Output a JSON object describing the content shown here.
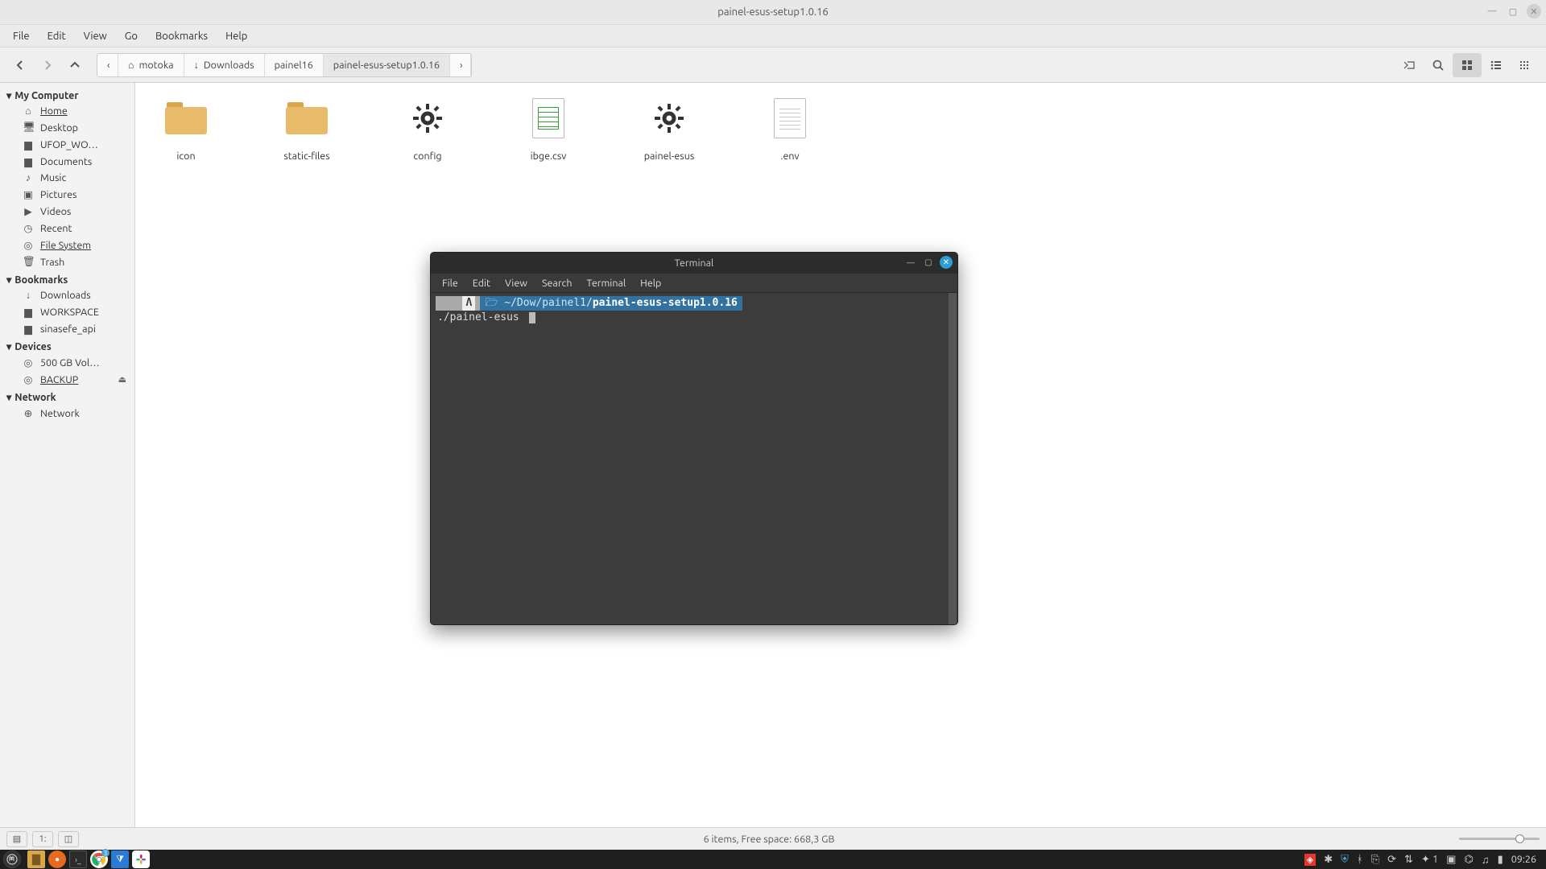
{
  "window": {
    "title": "painel-esus-setup1.0.16"
  },
  "menus": {
    "file": "File",
    "edit": "Edit",
    "view": "View",
    "go": "Go",
    "bookmarks": "Bookmarks",
    "help": "Help"
  },
  "breadcrumbs": {
    "root_user": "motoka",
    "downloads": "Downloads",
    "painel16": "painel16",
    "current": "painel-esus-setup1.0.16"
  },
  "sidebar": {
    "my_computer": "My Computer",
    "home": "Home",
    "desktop": "Desktop",
    "ufop": "UFOP_WO…",
    "documents": "Documents",
    "music": "Music",
    "pictures": "Pictures",
    "videos": "Videos",
    "recent": "Recent",
    "file_system": "File System",
    "trash": "Trash",
    "bookmarks": "Bookmarks",
    "bm_downloads": "Downloads",
    "bm_workspace": "WORKSPACE",
    "bm_sinasefe": "sinasefe_api",
    "devices": "Devices",
    "dev_500": "500 GB Vol…",
    "dev_backup": "BACKUP",
    "network": "Network",
    "net_network": "Network"
  },
  "files": {
    "icon": "icon",
    "static": "static-files",
    "config": "config",
    "ibge": "ibge.csv",
    "painel": "painel-esus",
    "env": ".env"
  },
  "status": {
    "text": "6 items, Free space: 668,3 GB"
  },
  "terminal": {
    "title": "Terminal",
    "menus": {
      "file": "File",
      "edit": "Edit",
      "view": "View",
      "search": "Search",
      "terminal": "Terminal",
      "help": "Help"
    },
    "prompt_arch": "Λ",
    "prompt_path_dim": "~/Dow/painel1/",
    "prompt_path_bright": "painel-esus-setup1.0.16",
    "command": "./painel-esus "
  },
  "taskbar": {
    "chrome_badge": "3",
    "notif_count": "1",
    "clock": "09:26"
  }
}
